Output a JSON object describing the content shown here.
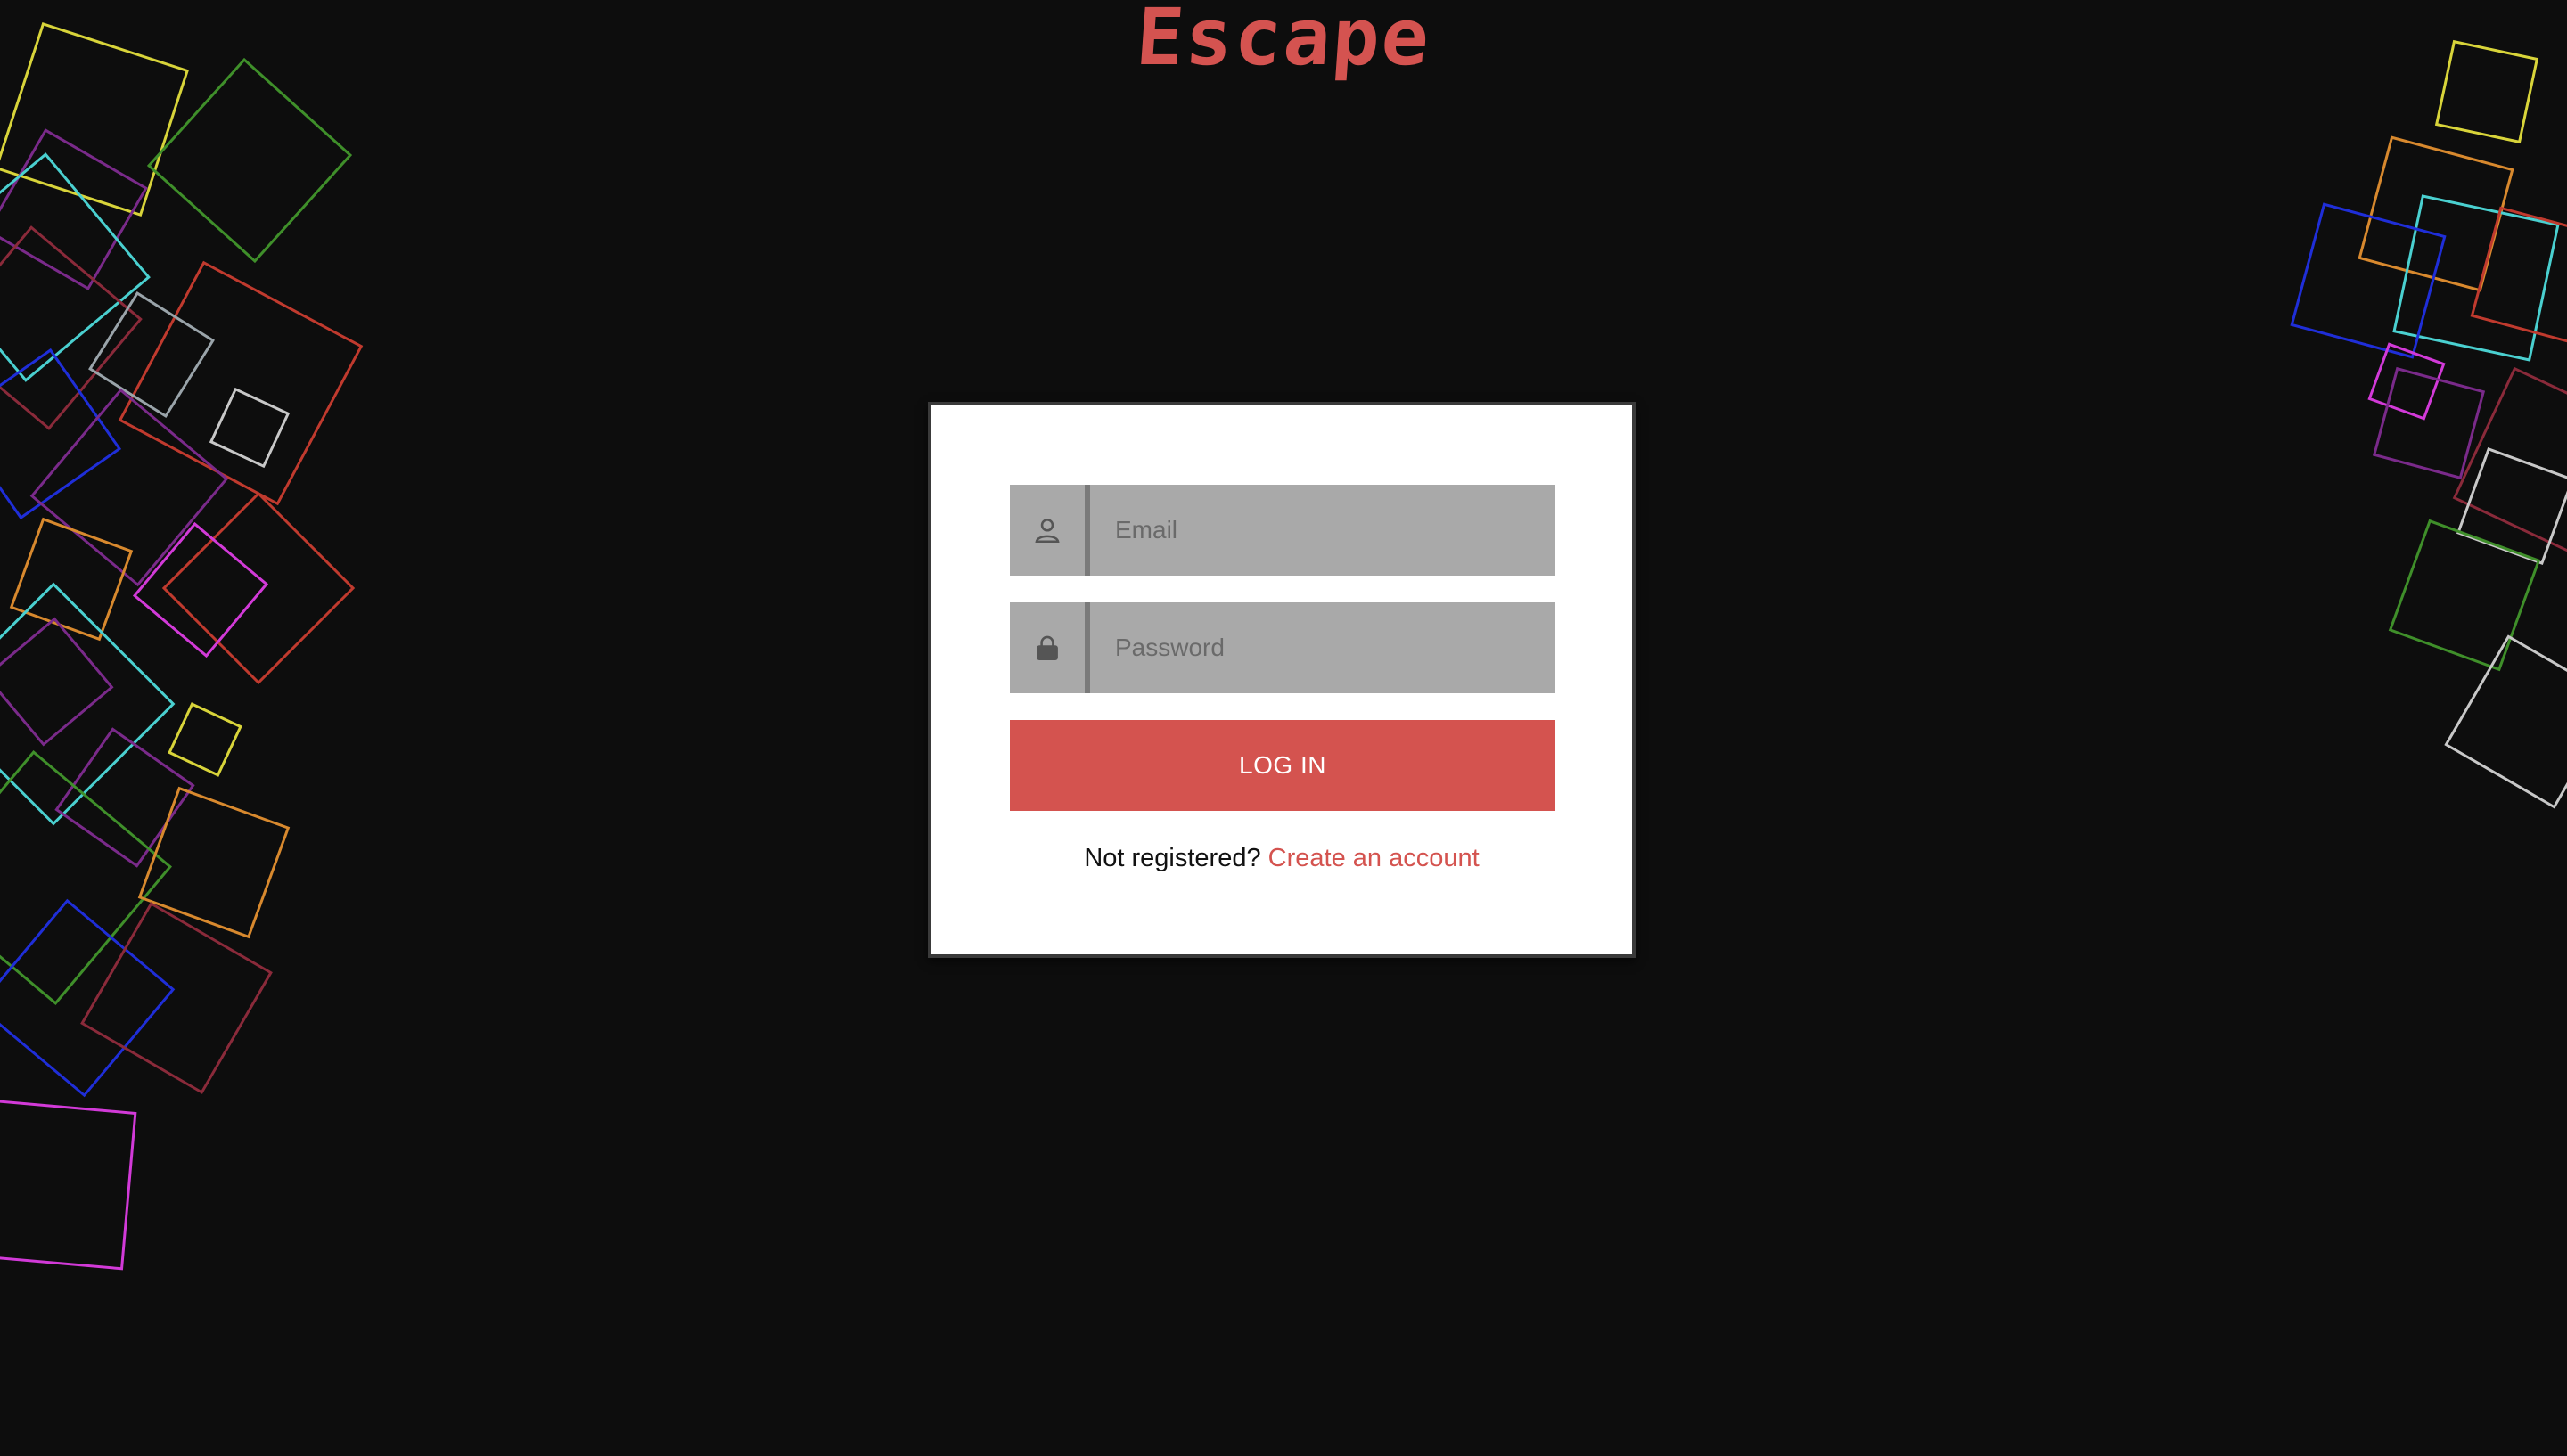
{
  "brand": {
    "title": "Escape",
    "color": "#d45350"
  },
  "login": {
    "email_placeholder": "Email",
    "email_value": "",
    "email_icon": "user-icon",
    "password_placeholder": "Password",
    "password_value": "",
    "password_icon": "lock-icon",
    "submit_label": "LOG IN",
    "register_prompt": "Not registered?",
    "register_link": "Create an account"
  },
  "colors": {
    "background": "#0d0d0d",
    "accent": "#d4534f",
    "field_bg": "#a9a9a9",
    "decor_palette": [
      "#d8d43a",
      "#3f8f2a",
      "#a52fa6",
      "#4ad0d0",
      "#c03a2e",
      "#9aa4aa",
      "#1f2ed8",
      "#d8892e",
      "#d23ad8",
      "#7a2a8a",
      "#8a2a3a",
      "#c8c8c8"
    ]
  }
}
